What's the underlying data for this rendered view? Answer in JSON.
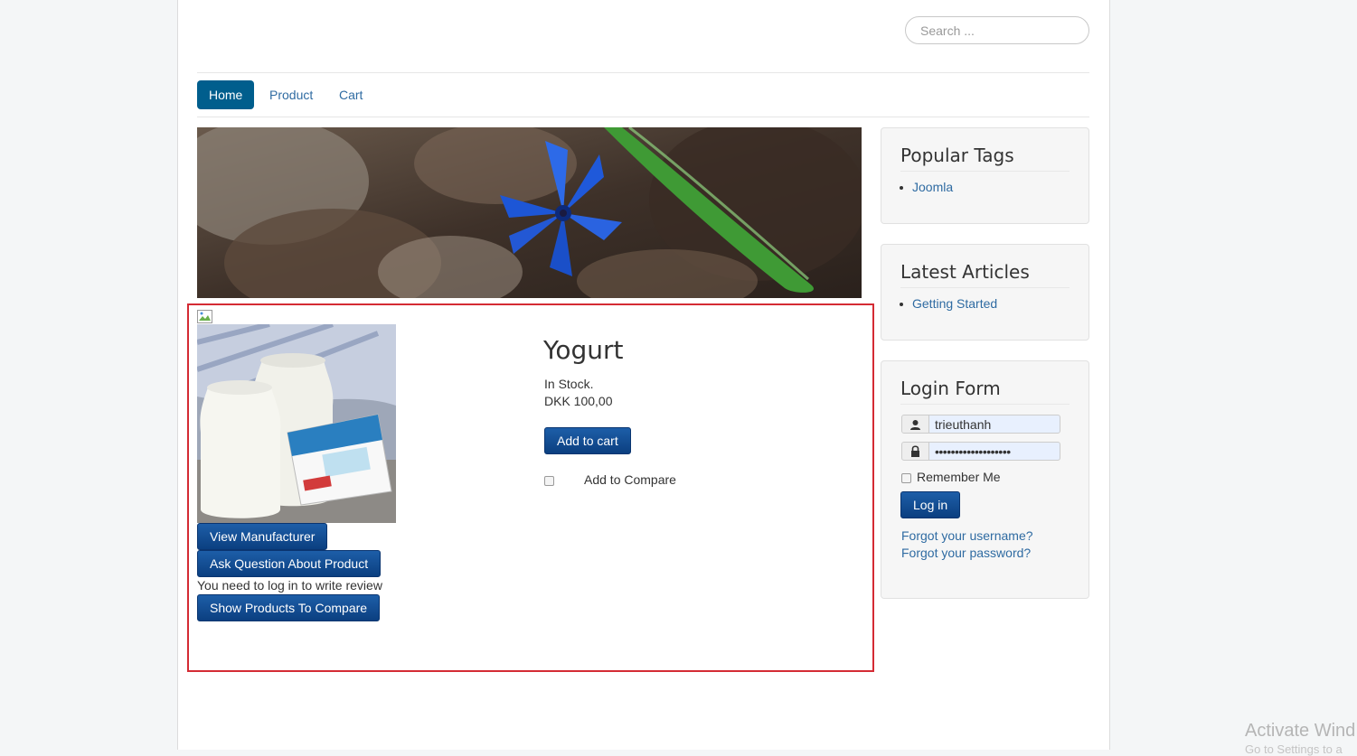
{
  "search": {
    "placeholder": "Search ..."
  },
  "nav": {
    "items": [
      {
        "label": "Home"
      },
      {
        "label": "Product"
      },
      {
        "label": "Cart"
      }
    ]
  },
  "product": {
    "title": "Yogurt",
    "stock": "In Stock.",
    "price": "DKK 100,00",
    "add_to_cart": "Add to cart",
    "compare_label": "Add to Compare",
    "view_manufacturer": "View Manufacturer",
    "ask_question": "Ask Question About Product",
    "review_note": "You need to log in to write review",
    "show_compare": "Show Products To Compare"
  },
  "sidebar": {
    "popular_tags": {
      "title": "Popular Tags",
      "items": [
        "Joomla"
      ]
    },
    "latest_articles": {
      "title": "Latest Articles",
      "items": [
        "Getting Started"
      ]
    },
    "login_form": {
      "title": "Login Form",
      "username": "trieuthanh",
      "password": "•••••••••••••••••••",
      "remember_label": "Remember Me",
      "login_button": "Log in",
      "forgot_username": "Forgot your username?",
      "forgot_password": "Forgot your password?"
    }
  },
  "watermark": {
    "line1": "Activate Wind",
    "line2": "Go to Settings to a"
  },
  "colors": {
    "accent": "#005e8d",
    "link": "#2f6ba2",
    "button": "#0b3f80",
    "highlight": "#d42b34"
  }
}
